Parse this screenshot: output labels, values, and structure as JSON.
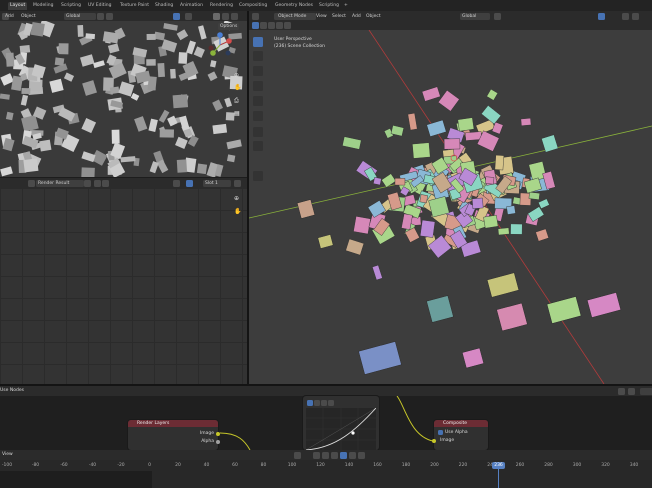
{
  "tabs": [
    "Layout",
    "Modeling",
    "Scripting",
    "UV Editing",
    "Texture Paint",
    "Shading",
    "Animation",
    "Rendering",
    "Compositing",
    "Geometry Nodes",
    "Scripting",
    "+"
  ],
  "left_top_header": {
    "add": "Add",
    "object": "Object",
    "transform": "Global",
    "options": "Options"
  },
  "image_editor_header": {
    "image_name": "Render Result",
    "slot": "Slot 1"
  },
  "viewport_header": {
    "mode": "Object Mode",
    "view": "View",
    "select": "Select",
    "add": "Add",
    "object": "Object",
    "transform": "Global"
  },
  "viewport_info": {
    "line1": "User Perspective",
    "line2": "(236) Scene Collection"
  },
  "node_editor": {
    "label": "Use Nodes",
    "render_layers": {
      "title": "Render Layers",
      "out1": "Image",
      "out2": "Alpha"
    },
    "composite": {
      "title": "Composite",
      "use_alpha": "Use Alpha",
      "in1": "Image"
    }
  },
  "timeline": {
    "label": "View",
    "current_frame": "236",
    "ticks": [
      "-100",
      "-80",
      "-60",
      "-40",
      "-20",
      "0",
      "20",
      "40",
      "60",
      "80",
      "100",
      "120",
      "140",
      "160",
      "180",
      "200",
      "220",
      "240",
      "260",
      "280",
      "300",
      "320",
      "340"
    ]
  },
  "colors": {
    "accent": "#4772b3",
    "current_frame": "#5680c2",
    "node_header_red": "#6c2c34",
    "link": "#c7c729",
    "x_axis": "#b33b3b",
    "y_axis": "#8ab33b"
  }
}
